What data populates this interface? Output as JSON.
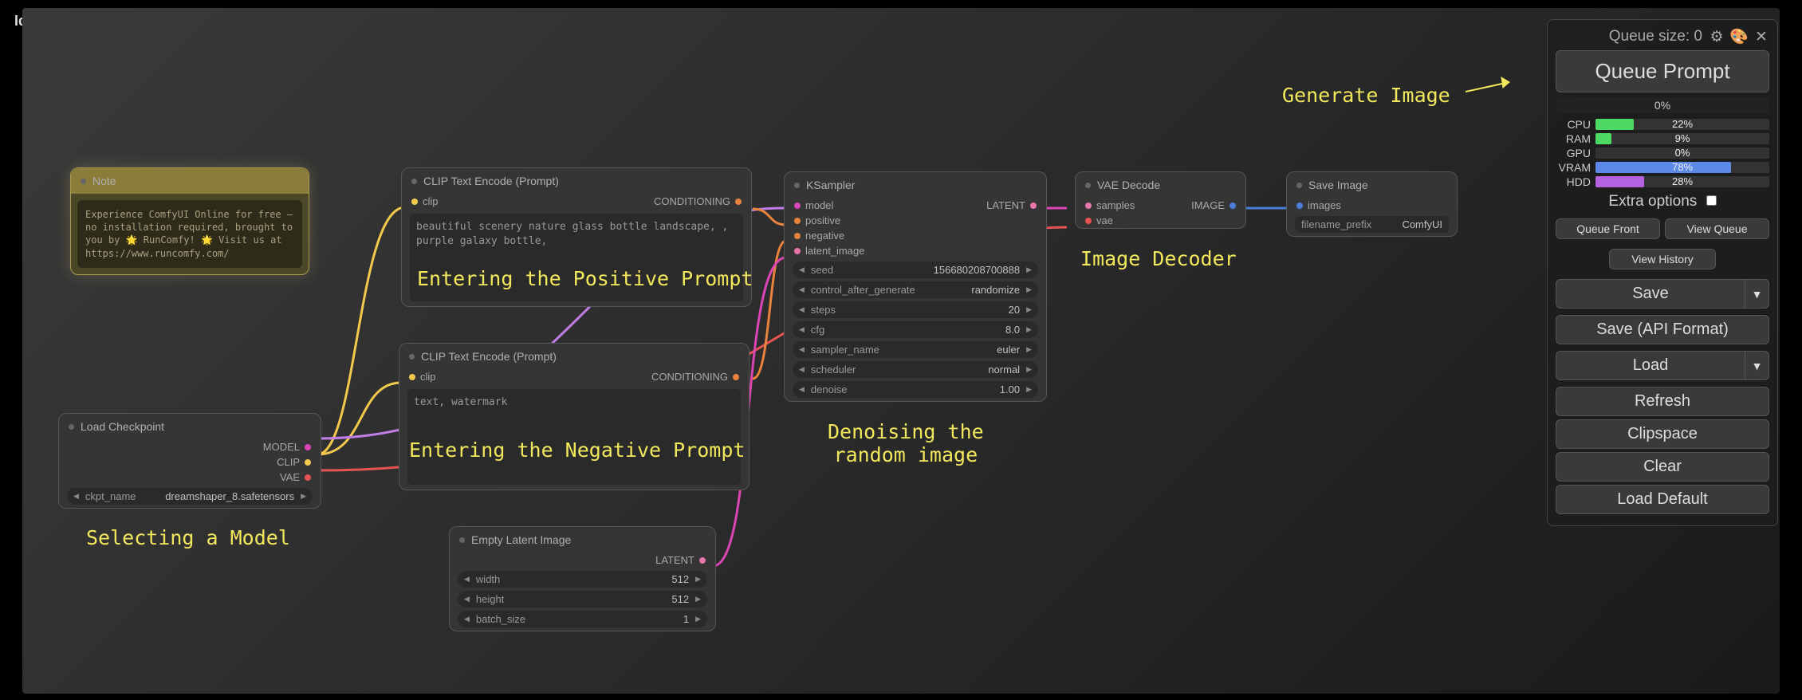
{
  "status": {
    "idle": "Idle"
  },
  "annotations": {
    "selecting_model": "Selecting a Model",
    "pos_prompt": "Entering the Positive Prompt",
    "neg_prompt": "Entering the Negative Prompt",
    "denoising": "Denoising the\nrandom image",
    "decoder": "Image Decoder",
    "generate": "Generate Image"
  },
  "nodes": {
    "note": {
      "title": "Note",
      "text": "Experience ComfyUI Online for free — no installation required, brought to you by 🌟 RunComfy! 🌟 Visit us at https://www.runcomfy.com/"
    },
    "load_checkpoint": {
      "title": "Load Checkpoint",
      "outputs": {
        "model": "MODEL",
        "clip": "CLIP",
        "vae": "VAE"
      },
      "widget": {
        "label": "ckpt_name",
        "value": "dreamshaper_8.safetensors"
      }
    },
    "clip_encode_pos": {
      "title": "CLIP Text Encode (Prompt)",
      "input": "clip",
      "output": "CONDITIONING",
      "text": "beautiful scenery nature glass bottle landscape, , purple galaxy bottle,"
    },
    "clip_encode_neg": {
      "title": "CLIP Text Encode (Prompt)",
      "input": "clip",
      "output": "CONDITIONING",
      "text": "text, watermark"
    },
    "empty_latent": {
      "title": "Empty Latent Image",
      "output": "LATENT",
      "widgets": {
        "width": {
          "label": "width",
          "value": "512"
        },
        "height": {
          "label": "height",
          "value": "512"
        },
        "batch_size": {
          "label": "batch_size",
          "value": "1"
        }
      }
    },
    "ksampler": {
      "title": "KSampler",
      "inputs": {
        "model": "model",
        "positive": "positive",
        "negative": "negative",
        "latent_image": "latent_image"
      },
      "output": "LATENT",
      "widgets": {
        "seed": {
          "label": "seed",
          "value": "156680208700888"
        },
        "control_after_generate": {
          "label": "control_after_generate",
          "value": "randomize"
        },
        "steps": {
          "label": "steps",
          "value": "20"
        },
        "cfg": {
          "label": "cfg",
          "value": "8.0"
        },
        "sampler_name": {
          "label": "sampler_name",
          "value": "euler"
        },
        "scheduler": {
          "label": "scheduler",
          "value": "normal"
        },
        "denoise": {
          "label": "denoise",
          "value": "1.00"
        }
      }
    },
    "vae_decode": {
      "title": "VAE Decode",
      "inputs": {
        "samples": "samples",
        "vae": "vae"
      },
      "output": "IMAGE"
    },
    "save_image": {
      "title": "Save Image",
      "input": "images",
      "widget": {
        "label": "filename_prefix",
        "value": "ComfyUI"
      }
    }
  },
  "panel": {
    "queue_size_label": "Queue size: 0",
    "queue_prompt": "Queue Prompt",
    "progress": "0%",
    "stats": {
      "cpu": {
        "label": "CPU",
        "value": "22%",
        "pct": 22,
        "color": "#4cd964"
      },
      "ram": {
        "label": "RAM",
        "value": "9%",
        "pct": 9,
        "color": "#4cd964"
      },
      "gpu": {
        "label": "GPU",
        "value": "0%",
        "pct": 0,
        "color": "#4cd964"
      },
      "vram": {
        "label": "VRAM",
        "value": "78%",
        "pct": 78,
        "color": "#5c8ae6"
      },
      "hdd": {
        "label": "HDD",
        "value": "28%",
        "pct": 28,
        "color": "#b462e0"
      }
    },
    "extra_options": "Extra options",
    "queue_front": "Queue Front",
    "view_queue": "View Queue",
    "view_history": "View History",
    "save": "Save",
    "save_api": "Save (API Format)",
    "load": "Load",
    "refresh": "Refresh",
    "clipspace": "Clipspace",
    "clear": "Clear",
    "load_default": "Load Default",
    "dropdown_arrow": "▼"
  }
}
